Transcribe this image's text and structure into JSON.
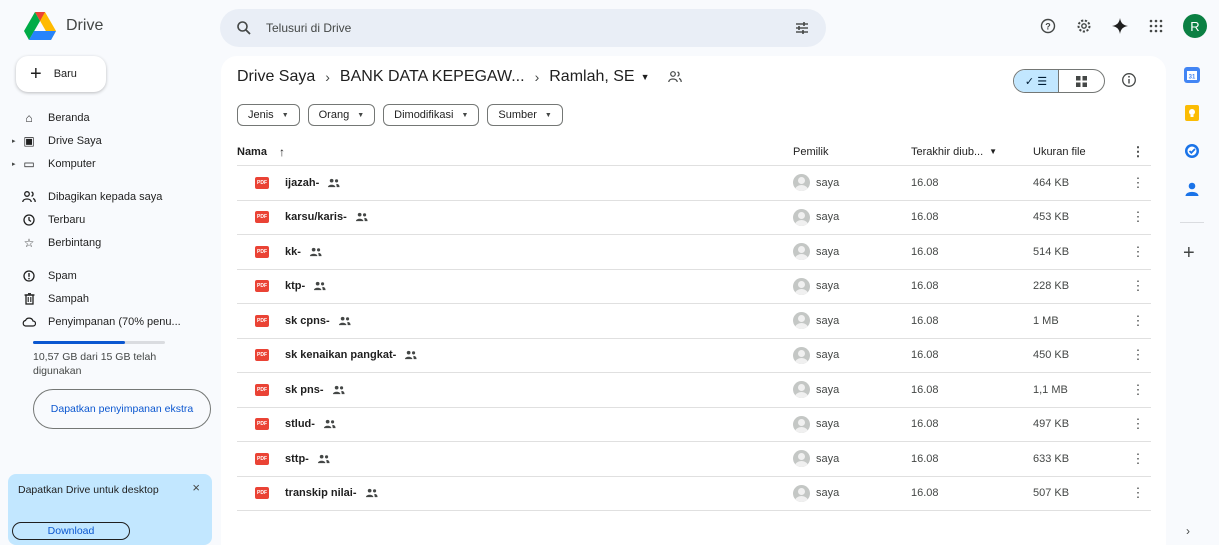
{
  "app": {
    "name": "Drive"
  },
  "search": {
    "placeholder": "Telusuri di Drive"
  },
  "account": {
    "initial": "R",
    "color": "#0b8043"
  },
  "sidebar": {
    "new_label": "Baru",
    "items": [
      {
        "label": "Beranda",
        "icon": "home-icon"
      },
      {
        "label": "Drive Saya",
        "icon": "my-drive-icon"
      },
      {
        "label": "Komputer",
        "icon": "computer-icon"
      },
      {
        "label": "Dibagikan kepada saya",
        "icon": "shared-with-me-icon"
      },
      {
        "label": "Terbaru",
        "icon": "clock-icon"
      },
      {
        "label": "Berbintang",
        "icon": "star-icon"
      },
      {
        "label": "Spam",
        "icon": "spam-icon"
      },
      {
        "label": "Sampah",
        "icon": "trash-icon"
      },
      {
        "label": "Penyimpanan (70% penu...",
        "icon": "cloud-icon"
      }
    ],
    "storage_used_fraction": 0.7,
    "storage_text": "10,57 GB dari 15 GB telah digunakan",
    "get_storage_label": "Dapatkan penyimpanan ekstra",
    "promo_text": "Dapatkan Drive untuk desktop",
    "promo_close": "×",
    "promo_button": "Download"
  },
  "breadcrumb": {
    "root": "Drive Saya",
    "sep": "›",
    "folder": "BANK DATA KEPEGAW...",
    "current": "Ramlah, SE"
  },
  "filters": [
    "Jenis",
    "Orang",
    "Dimodifikasi",
    "Sumber"
  ],
  "table": {
    "headers": {
      "name": "Nama",
      "owner": "Pemilik",
      "modified": "Terakhir diub...",
      "size": "Ukuran file"
    },
    "rows": [
      {
        "name": "ijazah-",
        "owner": "saya",
        "modified": "16.08",
        "size": "464 KB"
      },
      {
        "name": "karsu/karis-",
        "owner": "saya",
        "modified": "16.08",
        "size": "453 KB"
      },
      {
        "name": "kk-",
        "owner": "saya",
        "modified": "16.08",
        "size": "514 KB"
      },
      {
        "name": "ktp-",
        "owner": "saya",
        "modified": "16.08",
        "size": "228 KB"
      },
      {
        "name": "sk cpns-",
        "owner": "saya",
        "modified": "16.08",
        "size": "1 MB"
      },
      {
        "name": "sk kenaikan pangkat-",
        "owner": "saya",
        "modified": "16.08",
        "size": "450 KB"
      },
      {
        "name": "sk pns-",
        "owner": "saya",
        "modified": "16.08",
        "size": "1,1 MB"
      },
      {
        "name": "stlud-",
        "owner": "saya",
        "modified": "16.08",
        "size": "497 KB"
      },
      {
        "name": "sttp-",
        "owner": "saya",
        "modified": "16.08",
        "size": "633 KB"
      },
      {
        "name": "transkip nilai-",
        "owner": "saya",
        "modified": "16.08",
        "size": "507 KB"
      }
    ]
  },
  "file_icon_label": "PDF",
  "colors": {
    "accent": "#0b57d0",
    "selected": "#c2e7ff",
    "pdf": "#ea4335"
  }
}
